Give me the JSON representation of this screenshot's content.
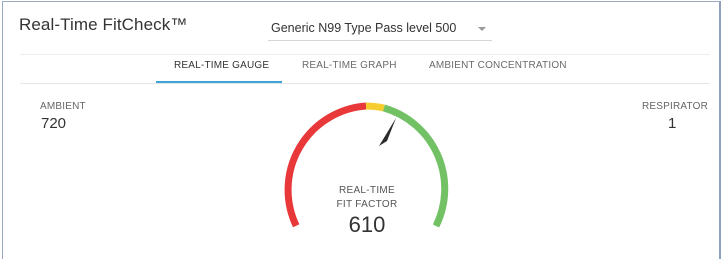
{
  "app": {
    "title": "Real-Time FitCheck™"
  },
  "selector": {
    "value": "Generic N99 Type Pass level 500"
  },
  "tabs": [
    {
      "label": "REAL-TIME GAUGE",
      "active": true
    },
    {
      "label": "REAL-TIME GRAPH",
      "active": false
    },
    {
      "label": "AMBIENT CONCENTRATION",
      "active": false
    }
  ],
  "ambient": {
    "label": "AMBIENT",
    "value": "720"
  },
  "respirator": {
    "label": "RESPIRATOR",
    "value": "1"
  },
  "gauge": {
    "caption_line1": "REAL-TIME",
    "caption_line2": "FIT FACTOR",
    "value": "610",
    "colors": {
      "red": "#e8383a",
      "yellow": "#f5cd2f",
      "green": "#72c265",
      "needle": "#2b2b2b"
    }
  },
  "colors": {
    "accent": "#3ea3d6",
    "border": "#9aa9c4"
  }
}
